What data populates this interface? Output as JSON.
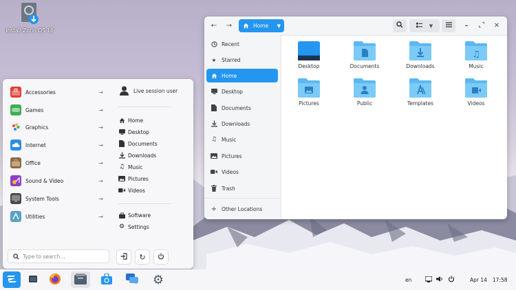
{
  "desktop_icon": {
    "label": "Install Zorin OS 16"
  },
  "file_manager": {
    "breadcrumb": "Home",
    "sidebar": [
      {
        "label": "Recent",
        "icon": "clock-icon"
      },
      {
        "label": "Starred",
        "icon": "star-icon"
      },
      {
        "label": "Home",
        "icon": "home-icon",
        "active": true
      },
      {
        "label": "Desktop",
        "icon": "desktop-icon"
      },
      {
        "label": "Documents",
        "icon": "document-icon"
      },
      {
        "label": "Downloads",
        "icon": "download-icon"
      },
      {
        "label": "Music",
        "icon": "music-icon"
      },
      {
        "label": "Pictures",
        "icon": "picture-icon"
      },
      {
        "label": "Videos",
        "icon": "video-icon"
      },
      {
        "label": "Trash",
        "icon": "trash-icon"
      },
      {
        "label": "Other Locations",
        "icon": "plus-icon"
      }
    ],
    "folders": [
      "Desktop",
      "Documents",
      "Downloads",
      "Music",
      "Pictures",
      "Public",
      "Templates",
      "Videos"
    ]
  },
  "menu": {
    "categories": [
      {
        "label": "Accessories",
        "icon": "toolbox-icon",
        "color": "#e0403a"
      },
      {
        "label": "Games",
        "icon": "gamepad-icon",
        "color": "#3fae55"
      },
      {
        "label": "Graphics",
        "icon": "palette-icon",
        "color": "#f2f2f2"
      },
      {
        "label": "Internet",
        "icon": "cloud-icon",
        "color": "#2a8ee8"
      },
      {
        "label": "Office",
        "icon": "briefcase-icon",
        "color": "#8a6a4a"
      },
      {
        "label": "Sound & Video",
        "icon": "media-icon",
        "color": "#8b3fc6"
      },
      {
        "label": "System Tools",
        "icon": "monitor-icon",
        "color": "#4a4a4a"
      },
      {
        "label": "Utilities",
        "icon": "utilities-icon",
        "color": "#5aa0c8"
      }
    ],
    "user": "Live session user",
    "places": [
      "Home",
      "Desktop",
      "Documents",
      "Downloads",
      "Music",
      "Pictures",
      "Videos"
    ],
    "system": [
      "Software",
      "Settings"
    ],
    "search_placeholder": "Type to search..."
  },
  "taskbar": {
    "lang": "en",
    "date": "Apr 14",
    "time": "17:58",
    "accent": "#2596f0"
  }
}
